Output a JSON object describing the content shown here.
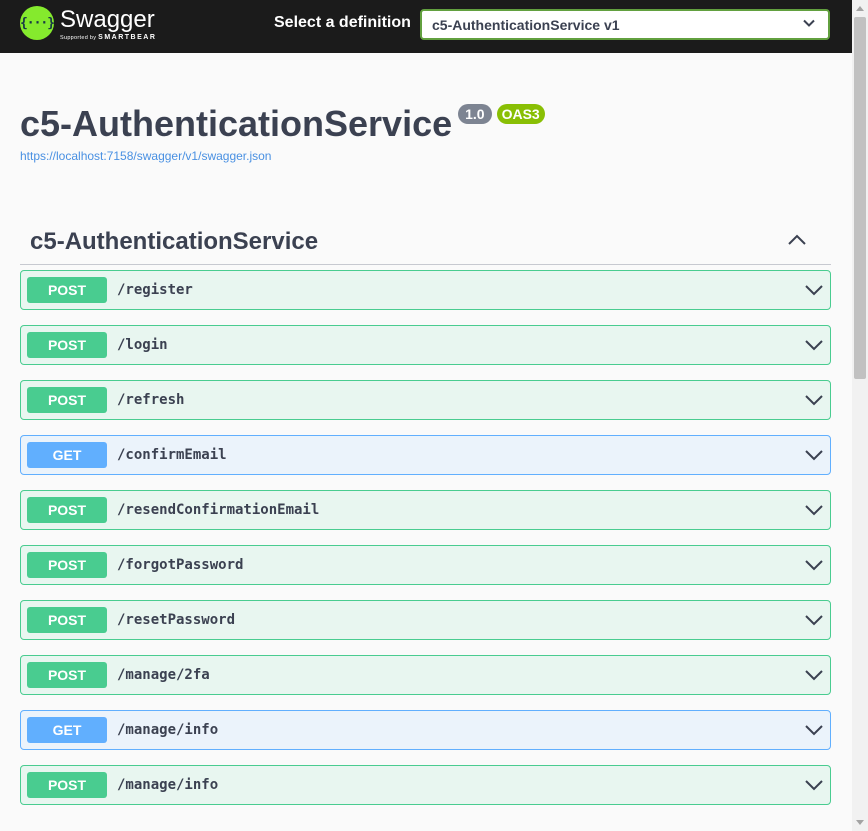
{
  "topbar": {
    "logo_word": "Swagger",
    "logo_sub_prefix": "Supported by",
    "logo_sub_brand": "SMARTBEAR",
    "logo_glyph": "{···}",
    "select_label": "Select a definition",
    "selected_definition": "c5-AuthenticationService v1"
  },
  "info": {
    "title": "c5-AuthenticationService",
    "version": "1.0",
    "oas": "OAS3",
    "spec_url": "https://localhost:7158/swagger/v1/swagger.json"
  },
  "tag": {
    "name": "c5-AuthenticationService"
  },
  "operations": [
    {
      "method": "POST",
      "path": "/register"
    },
    {
      "method": "POST",
      "path": "/login"
    },
    {
      "method": "POST",
      "path": "/refresh"
    },
    {
      "method": "GET",
      "path": "/confirmEmail"
    },
    {
      "method": "POST",
      "path": "/resendConfirmationEmail"
    },
    {
      "method": "POST",
      "path": "/forgotPassword"
    },
    {
      "method": "POST",
      "path": "/resetPassword"
    },
    {
      "method": "POST",
      "path": "/manage/2fa"
    },
    {
      "method": "GET",
      "path": "/manage/info"
    },
    {
      "method": "POST",
      "path": "/manage/info"
    }
  ],
  "colors": {
    "post": "#49cc90",
    "get": "#61affe",
    "topbar": "#1b1b1b",
    "accent": "#85ea2d"
  }
}
